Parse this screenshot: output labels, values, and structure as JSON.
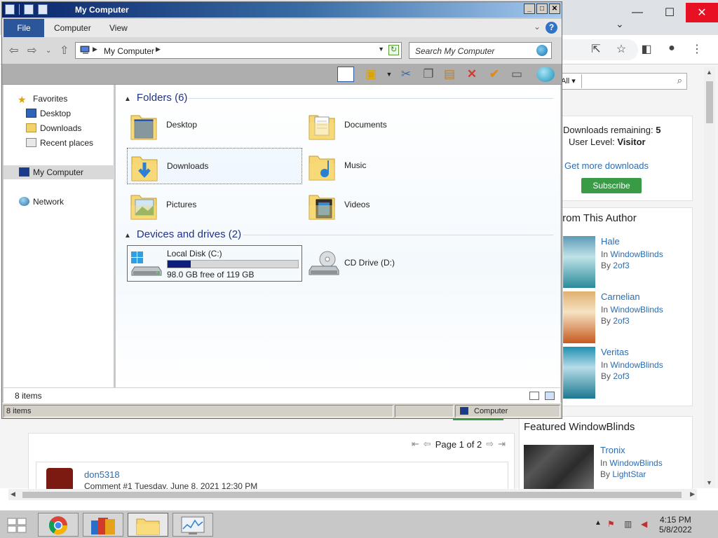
{
  "explorer": {
    "title": "My Computer",
    "ribbon_tabs": [
      "File",
      "Computer",
      "View"
    ],
    "address": {
      "path": "My Computer"
    },
    "search": {
      "placeholder": "Search My Computer"
    },
    "nav": {
      "favorites": "Favorites",
      "desktop": "Desktop",
      "downloads": "Downloads",
      "recent": "Recent places",
      "computer": "My Computer",
      "network": "Network"
    },
    "folders_header": "Folders (6)",
    "folders": [
      {
        "name": "Desktop",
        "icon": "desktop-folder-icon"
      },
      {
        "name": "Documents",
        "icon": "documents-folder-icon"
      },
      {
        "name": "Downloads",
        "icon": "downloads-folder-icon"
      },
      {
        "name": "Music",
        "icon": "music-folder-icon"
      },
      {
        "name": "Pictures",
        "icon": "pictures-folder-icon"
      },
      {
        "name": "Videos",
        "icon": "videos-folder-icon"
      }
    ],
    "drives_header": "Devices and drives (2)",
    "drives": [
      {
        "name": "Local Disk (C:)",
        "free": "98.0 GB free of 119 GB",
        "used_fraction": 0.18
      },
      {
        "name": "CD Drive (D:)"
      }
    ],
    "item_count": "8 items",
    "status_items": "8 items",
    "status_location": "Computer"
  },
  "browser": {
    "search_select": "All",
    "downloads_remaining_label": "Downloads remaining:",
    "downloads_remaining_value": "5",
    "user_level_label": "User Level:",
    "user_level_value": "Visitor",
    "get_more": "Get more downloads",
    "subscribe": "Subscribe",
    "author_title": "From This Author",
    "author_skins": [
      {
        "name": "Hale",
        "category": "WindowBlinds",
        "author": "2of3"
      },
      {
        "name": "Carnelian",
        "category": "WindowBlinds",
        "author": "2of3"
      },
      {
        "name": "Veritas",
        "category": "WindowBlinds",
        "author": "2of3"
      }
    ],
    "featured_title": "Featured WindowBlinds",
    "featured_skin": {
      "name": "Tronix",
      "category": "WindowBlinds",
      "author": "LightStar"
    },
    "in_label": "In",
    "by_label": "By",
    "pager": "Page 1 of 2",
    "comment_user": "don5318",
    "comment_meta": "Comment #1 Tuesday, June 8, 2021 12:30 PM"
  },
  "taskbar": {
    "time": "4:15 PM",
    "date": "5/8/2022"
  }
}
